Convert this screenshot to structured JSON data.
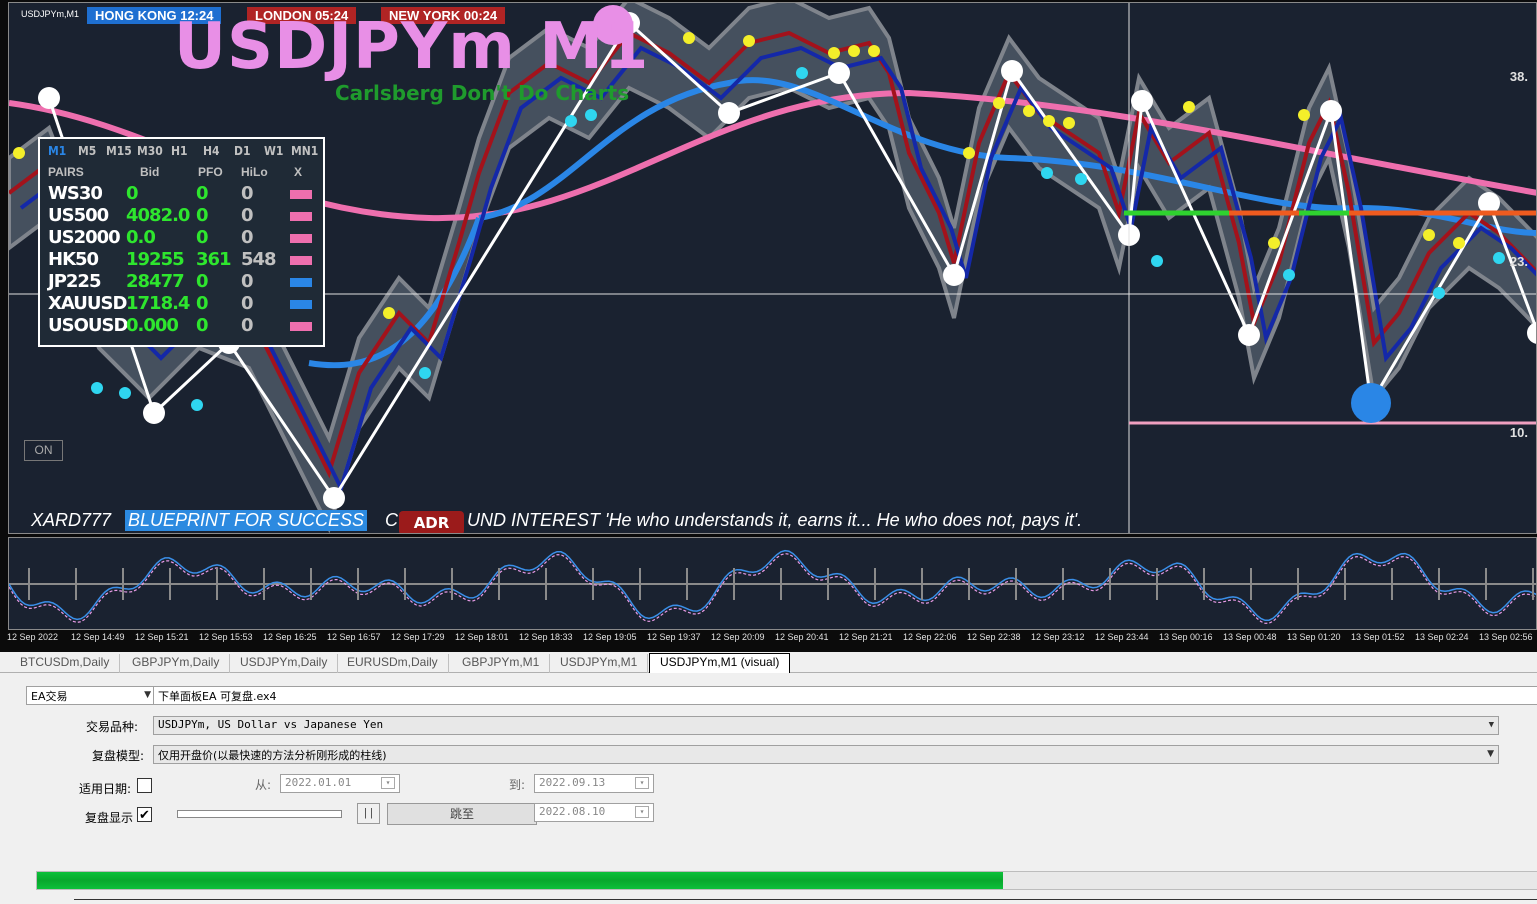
{
  "chart": {
    "symbol_label": "USDJPYm,M1",
    "title": "USDJPYm M1",
    "subtitle": "Carlsberg Don't Do Charts",
    "clocks": [
      {
        "label": "HONG KONG 12:24",
        "color": "#1e6fd1"
      },
      {
        "label": "LONDON  05:24",
        "color": "#b02424"
      },
      {
        "label": "NEW YORK  00:24",
        "color": "#b02424"
      }
    ],
    "price_labels": [
      "38.",
      "23.",
      "10."
    ],
    "on_button": "ON",
    "footer": {
      "author": "XARD777",
      "blueprint": "BLUEPRINT FOR SUCCESS",
      "adr": "ADR W1",
      "prefix": "C",
      "quote": "UND INTEREST  'He who understands it, earns it... He who does not, pays it'."
    },
    "time_labels": [
      "12 Sep 2022",
      "12 Sep 14:49",
      "12 Sep 15:21",
      "12 Sep 15:53",
      "12 Sep 16:25",
      "12 Sep 16:57",
      "12 Sep 17:29",
      "12 Sep 18:01",
      "12 Sep 18:33",
      "12 Sep 19:05",
      "12 Sep 19:37",
      "12 Sep 20:09",
      "12 Sep 20:41",
      "12 Sep 21:21",
      "12 Sep 22:06",
      "12 Sep 22:38",
      "12 Sep 23:12",
      "12 Sep 23:44",
      "13 Sep 00:16",
      "13 Sep 00:48",
      "13 Sep 01:20",
      "13 Sep 01:52",
      "13 Sep 02:24",
      "13 Sep 02:56"
    ],
    "colors": {
      "pink_ma": "#ee6fae",
      "blue_ma": "#2a86e6",
      "red_line": "#a3121b",
      "navy_line": "#1428a8",
      "band": "#4a5563",
      "band_edge": "#8a8f96"
    }
  },
  "quote_panel": {
    "timeframes": [
      "M1",
      "M5",
      "M15",
      "M30",
      "H1",
      "H4",
      "D1",
      "W1",
      "MN1"
    ],
    "headers": [
      "PAIRS",
      "Bid",
      "PFO",
      "HiLo",
      "X"
    ],
    "rows": [
      {
        "pair": "WS30",
        "bid": "0",
        "pfo": "0",
        "hilo": "0",
        "mark": "#ee6fae"
      },
      {
        "pair": "US500",
        "bid": "4082.0",
        "pfo": "0",
        "hilo": "0",
        "mark": "#ee6fae"
      },
      {
        "pair": "US2000",
        "bid": "0.0",
        "pfo": "0",
        "hilo": "0",
        "mark": "#ee6fae"
      },
      {
        "pair": "HK50",
        "bid": "19255",
        "pfo": "361",
        "hilo": "548",
        "mark": "#ee6fae"
      },
      {
        "pair": "JP225",
        "bid": "28477",
        "pfo": "0",
        "hilo": "0",
        "mark": "#2a86e6"
      },
      {
        "pair": "XAUUSD",
        "bid": "1718.4",
        "pfo": "0",
        "hilo": "0",
        "mark": "#2a86e6"
      },
      {
        "pair": "USOUSD",
        "bid": "0.000",
        "pfo": "0",
        "hilo": "0",
        "mark": "#ee6fae"
      }
    ]
  },
  "tabs": [
    "BTCUSDm,Daily",
    "GBPJPYm,Daily",
    "USDJPYm,Daily",
    "EURUSDm,Daily",
    "GBPJPYm,M1",
    "USDJPYm,M1",
    "USDJPYm,M1 (visual)"
  ],
  "active_tab": 6,
  "tester": {
    "mode": "EA交易",
    "ea_file": "下单面板EA 可复盘.ex4",
    "symbol_label": "交易品种:",
    "symbol_value": "USDJPYm, US Dollar vs Japanese Yen",
    "model_label": "复盘模型:",
    "model_value": "仅用开盘价(以最快速的方法分析刚形成的柱线)",
    "use_date_label": "适用日期:",
    "from_label": "从:",
    "from_value": "2022.01.01",
    "to_label": "到:",
    "to_value": "2022.09.13",
    "visual_label": "复盘显示",
    "visual_checked": "✔",
    "pause_label": "| |",
    "jump_label": "跳至",
    "jump_date": "2022.08.10",
    "progress": 0.64
  }
}
